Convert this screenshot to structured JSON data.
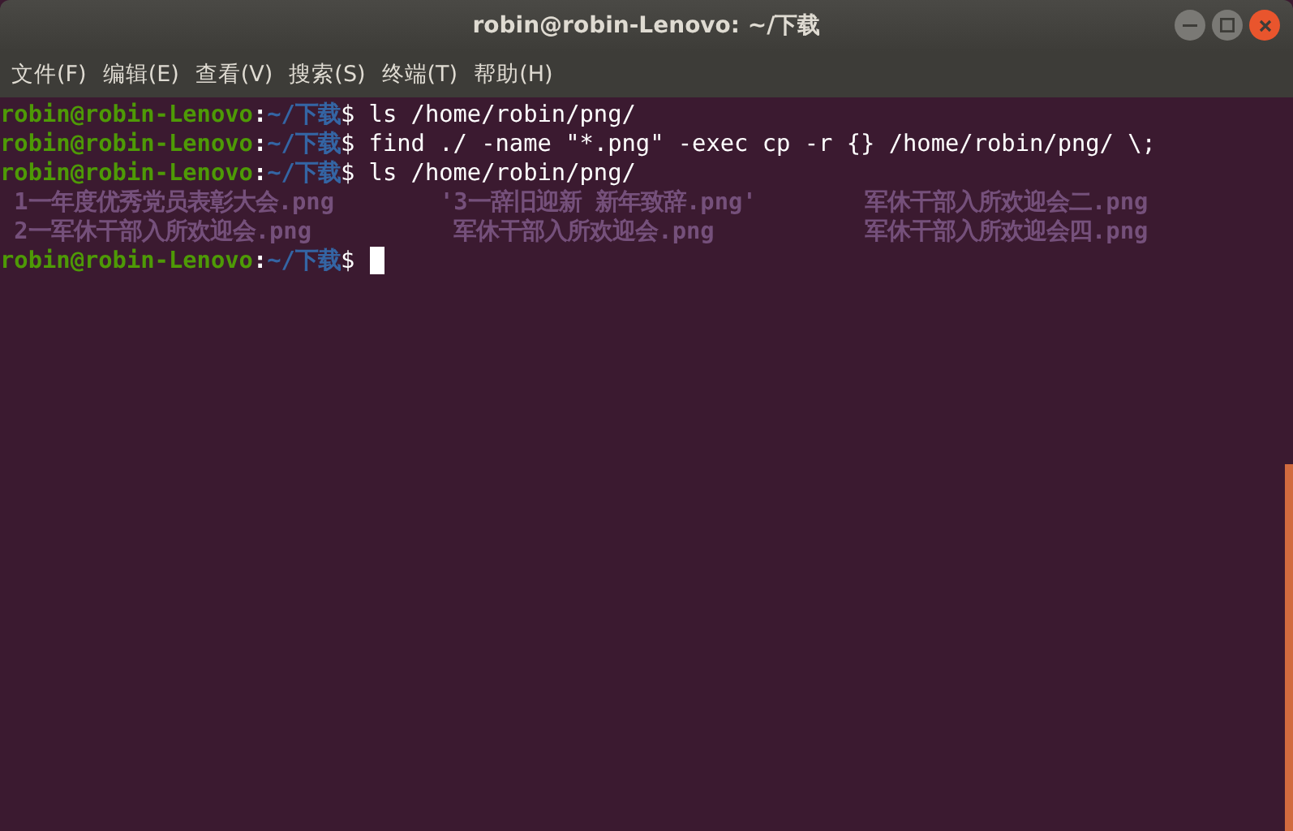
{
  "window": {
    "title": "robin@robin-Lenovo: ~/下载"
  },
  "menu": [
    "文件(F)",
    "编辑(E)",
    "查看(V)",
    "搜索(S)",
    "终端(T)",
    "帮助(H)"
  ],
  "lines": [
    {
      "kind": "prompt",
      "user": "robin@robin-Lenovo",
      "sep": ":",
      "path": "~/下载",
      "symbol": "$",
      "command": "ls /home/robin/png/",
      "cursor": false
    },
    {
      "kind": "prompt",
      "user": "robin@robin-Lenovo",
      "sep": ":",
      "path": "~/下载",
      "symbol": "$",
      "command": "find ./ -name \"*.png\" -exec cp -r {} /home/robin/png/ \\;",
      "cursor": false
    },
    {
      "kind": "prompt",
      "user": "robin@robin-Lenovo",
      "sep": ":",
      "path": "~/下载",
      "symbol": "$",
      "command": "ls /home/robin/png/",
      "cursor": false
    },
    {
      "kind": "listing",
      "files": [
        " 1一年度优秀党员表彰大会.png",
        "'3一辞旧迎新 新年致辞.png'",
        "军休干部入所欢迎会二.png"
      ]
    },
    {
      "kind": "listing",
      "files": [
        " 2一军休干部入所欢迎会.png",
        " 军休干部入所欢迎会.png",
        "军休干部入所欢迎会四.png"
      ]
    },
    {
      "kind": "prompt",
      "user": "robin@robin-Lenovo",
      "sep": ":",
      "path": "~/下载",
      "symbol": "$",
      "cursor": true
    }
  ]
}
